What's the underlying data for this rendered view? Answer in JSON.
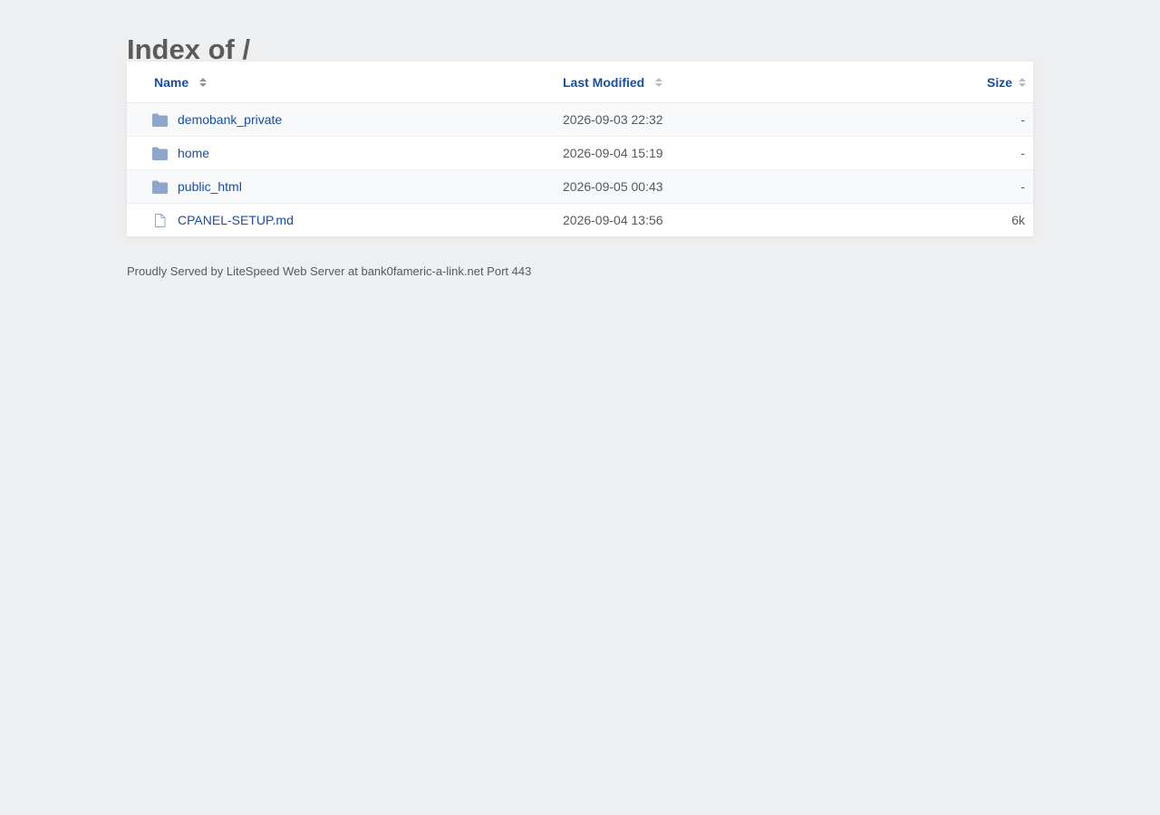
{
  "page": {
    "title": "Index of /"
  },
  "table": {
    "headers": {
      "name": "Name",
      "modified": "Last Modified",
      "size": "Size"
    },
    "rows": [
      {
        "type": "folder",
        "icon": "folder-icon",
        "name": "demobank_private",
        "modified": "2026-09-03 22:32",
        "size": "-"
      },
      {
        "type": "folder",
        "icon": "folder-icon",
        "name": "home",
        "modified": "2026-09-04 15:19",
        "size": "-"
      },
      {
        "type": "folder",
        "icon": "folder-icon",
        "name": "public_html",
        "modified": "2026-09-05 00:43",
        "size": "-"
      },
      {
        "type": "file",
        "icon": "file-icon",
        "name": "CPANEL-SETUP.md",
        "modified": "2026-09-04 13:56",
        "size": "6k"
      }
    ]
  },
  "footer": {
    "text": "Proudly Served by LiteSpeed Web Server at bank0fameric-a-link.net Port 443"
  },
  "colors": {
    "background": "#eeeff1",
    "link": "#174ea6",
    "folder_icon": "#8ea6c8",
    "file_icon": "#8ea6c8",
    "text": "#555a60"
  }
}
